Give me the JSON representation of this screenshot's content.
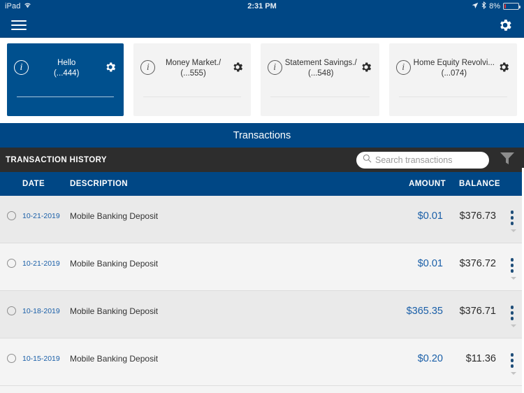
{
  "statusbar": {
    "carrier": "iPad",
    "wifi_icon": "wifi-icon",
    "time": "2:31 PM",
    "location_icon": "location-arrow-icon",
    "bluetooth_icon": "bluetooth-icon",
    "battery_percent": "8%",
    "battery_level": 8
  },
  "navbar": {
    "menu_icon": "hamburger-menu-icon",
    "settings_icon": "gear-icon"
  },
  "accounts": [
    {
      "name": "Hello",
      "number": "(...444)",
      "selected": true,
      "info_icon": "info-icon",
      "settings_icon": "gear-icon"
    },
    {
      "name": "Money Market./",
      "number": "(...555)",
      "selected": false,
      "info_icon": "info-icon",
      "settings_icon": "gear-icon"
    },
    {
      "name": "Statement Savings./",
      "number": "(...548)",
      "selected": false,
      "info_icon": "info-icon",
      "settings_icon": "gear-icon"
    },
    {
      "name": "Home Equity Revolvi...",
      "number": "(...074)",
      "selected": false,
      "info_icon": "info-icon",
      "settings_icon": "gear-icon"
    }
  ],
  "section": {
    "transactions_title": "Transactions",
    "history_label": "TRANSACTION HISTORY"
  },
  "search": {
    "placeholder": "Search transactions",
    "value": "",
    "icon": "search-icon"
  },
  "filter": {
    "icon": "filter-funnel-icon"
  },
  "table": {
    "headers": {
      "date": "DATE",
      "description": "DESCRIPTION",
      "amount": "AMOUNT",
      "balance": "BALANCE"
    },
    "rows": [
      {
        "date": "10-21-2019",
        "description": "Mobile Banking Deposit",
        "amount": "$0.01",
        "balance": "$376.73"
      },
      {
        "date": "10-21-2019",
        "description": "Mobile Banking Deposit",
        "amount": "$0.01",
        "balance": "$376.72"
      },
      {
        "date": "10-18-2019",
        "description": "Mobile Banking Deposit",
        "amount": "$365.35",
        "balance": "$376.71"
      },
      {
        "date": "10-15-2019",
        "description": "Mobile Banking Deposit",
        "amount": "$0.20",
        "balance": "$11.36"
      }
    ]
  },
  "colors": {
    "brand_blue": "#004785",
    "card_selected": "#00508e",
    "toolbar_dark": "#2d2d2d",
    "link_blue": "#1a5fa8",
    "battery_red": "#e03030"
  }
}
